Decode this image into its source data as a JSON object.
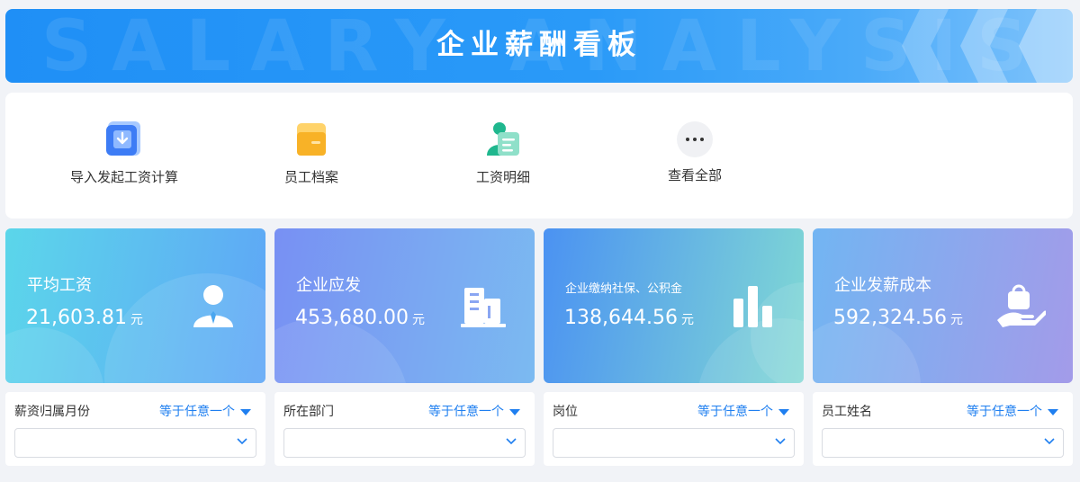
{
  "banner": {
    "title": "企业薪酬看板",
    "watermark": "SALARY ANALYSIS"
  },
  "actions": [
    {
      "label": "导入发起工资计算",
      "icon": "import-download-icon"
    },
    {
      "label": "员工档案",
      "icon": "folder-icon"
    },
    {
      "label": "工资明细",
      "icon": "payroll-detail-icon"
    },
    {
      "label": "查看全部",
      "icon": "more-dots-icon"
    }
  ],
  "cards": [
    {
      "title": "平均工资",
      "value": "21,603.81",
      "unit": "元",
      "icon": "employee-icon"
    },
    {
      "title": "企业应发",
      "value": "453,680.00",
      "unit": "元",
      "icon": "building-icon"
    },
    {
      "title": "企业缴纳社保、公积金",
      "value": "138,644.56",
      "unit": "元",
      "icon": "bar-chart-icon"
    },
    {
      "title": "企业发薪成本",
      "value": "592,324.56",
      "unit": "元",
      "icon": "hand-money-bag-icon"
    }
  ],
  "filters": [
    {
      "label": "薪资归属月份",
      "operator": "等于任意一个",
      "value": ""
    },
    {
      "label": "所在部门",
      "operator": "等于任意一个",
      "value": ""
    },
    {
      "label": "岗位",
      "operator": "等于任意一个",
      "value": ""
    },
    {
      "label": "员工姓名",
      "operator": "等于任意一个",
      "value": ""
    }
  ],
  "colors": {
    "banner": "#1f8ff6",
    "accent": "#1f7ff0",
    "card1": [
      "#5ad3ea",
      "#5fa5f6"
    ],
    "card2": [
      "#7a8ff3",
      "#7ab8f1"
    ],
    "card3": [
      "#4a93f2",
      "#7fd6d6"
    ],
    "card4": [
      "#74b5f2",
      "#a39ce9"
    ]
  }
}
